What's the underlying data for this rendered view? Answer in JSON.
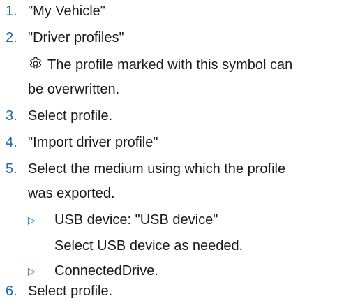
{
  "steps": [
    {
      "num": "1.",
      "text": "\"My Vehicle\""
    },
    {
      "num": "2.",
      "text": "\"Driver profiles\""
    },
    {
      "num": "3.",
      "text": "Select profile."
    },
    {
      "num": "4.",
      "text": "\"Import driver profile\""
    },
    {
      "num": "5.",
      "text_line1": "Select the medium using which the profile",
      "text_line2": "was exported."
    },
    {
      "num": "6.",
      "text": "Select profile."
    }
  ],
  "note": {
    "icon": "gear-icon",
    "line1": "The profile marked with this symbol can",
    "line2": "be overwritten."
  },
  "bullets": [
    {
      "marker": "▷",
      "text": "USB device: \"USB device\"",
      "subtext": "Select USB device as needed."
    },
    {
      "marker": "▷",
      "text": "ConnectedDrive."
    }
  ],
  "colors": {
    "accent": "#1c69b8",
    "text": "#1a1a1a"
  }
}
